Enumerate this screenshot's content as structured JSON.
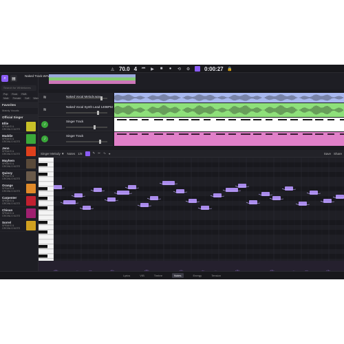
{
  "transport": {
    "tempo": "70.0",
    "beats": "4",
    "time": "0:00:27"
  },
  "sidebar": {
    "search_placeholder": "Search for Whitetones",
    "section_favorites": "Favorites",
    "section_official": "Official Singer",
    "singers": [
      {
        "name": "Ellie",
        "sub": "SPEAKS & GROWLS NOTE",
        "color": "#c7c028"
      },
      {
        "name": "Maddie",
        "sub": "SPEAKS & GROWLS NOTE",
        "color": "#3ba83a"
      },
      {
        "name": "Jenn",
        "sub": "SPEAKS & GROWLS NOTE",
        "color": "#e0401c"
      },
      {
        "name": "Mayhem",
        "sub": "SPEAKS & GROWLS NOTE",
        "color": "#5a4a3a"
      },
      {
        "name": "Quinzy",
        "sub": "SPEAKS & GROWLS NOTE",
        "color": "#6a5a4a"
      },
      {
        "name": "Orange",
        "sub": "SPEAKS & GROWLS NOTE",
        "color": "#e08a2a"
      },
      {
        "name": "Carpenter",
        "sub": "SPEAKS & GROWLS NOTE",
        "color": "#c02030"
      },
      {
        "name": "Chisun",
        "sub": "SPEAKS & GROWLS NOTE",
        "color": "#a02070"
      },
      {
        "name": "Sorrel",
        "sub": "SPEAKS & GROWLS NOTE",
        "color": "#d0a020"
      }
    ]
  },
  "tracks": [
    {
      "name": "Naked Vocal Melody.wav",
      "color": "#a8b8f0",
      "icon": "waveform-icon"
    },
    {
      "name": "Naked Vocal Synth Lead 140BPM",
      "color": "#8ee07a",
      "icon": "waveform-icon"
    },
    {
      "name": "Singer Track",
      "color": "#ffffff",
      "icon": "singer-icon"
    },
    {
      "name": "Singer Track",
      "color": "#e080c8",
      "icon": "singer-icon"
    }
  ],
  "top_clip_label": "Naked Track.WAV",
  "editor": {
    "track_label": "Singer Melody ▼",
    "mode_label": "Notes",
    "value": "1/8",
    "right_buttons": [
      "Save",
      "Share"
    ]
  },
  "bottom_tabs": [
    "Lyrics",
    "VIB",
    "Timbre",
    "Notes",
    "Energy",
    "Tension"
  ],
  "bottom_active": "Notes"
}
